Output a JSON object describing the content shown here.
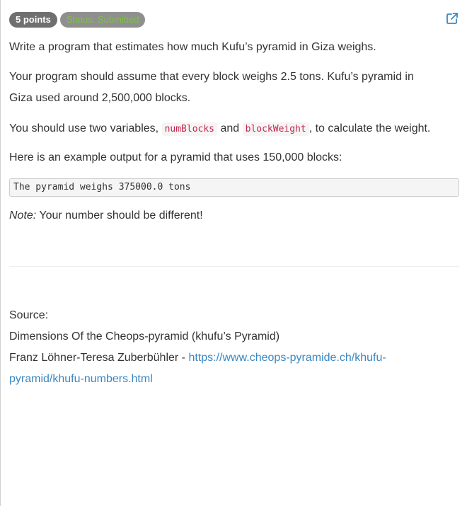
{
  "badges": {
    "points": "5 points",
    "status": "Status: Submitted"
  },
  "icons": {
    "external_link": "external-link-icon"
  },
  "colors": {
    "link": "#3a87c2",
    "status_text": "#7fc241",
    "code_text": "#c7254e"
  },
  "problem": {
    "intro": "Write a program that estimates how much Kufu’s pyramid in Giza weighs.",
    "assume_line1": "Your program should assume that every block weighs 2.5 tons. Kufu’s pyramid in",
    "assume_line2": "Giza used around 2,500,000 blocks.",
    "vars_prefix": "You should use two variables,",
    "var1": "numBlocks",
    "vars_and": "and",
    "var2": "blockWeight",
    "vars_suffix": ", to calculate the weight.",
    "example_intro": "Here is an example output for a pyramid that uses 150,000 blocks:",
    "example_output": "The pyramid weighs 375000.0 tons",
    "note_label": "Note:",
    "note_text": "Your number should be different!"
  },
  "source": {
    "label": "Source:",
    "title": "Dimensions Of the Cheops-pyramid (khufu’s Pyramid)",
    "authors": "Franz Löhner-Teresa Zuberbühler -",
    "url_line1": "https://www.cheops-pyramide.ch/khufu-",
    "url_line2": "pyramid/khufu-numbers.html"
  }
}
